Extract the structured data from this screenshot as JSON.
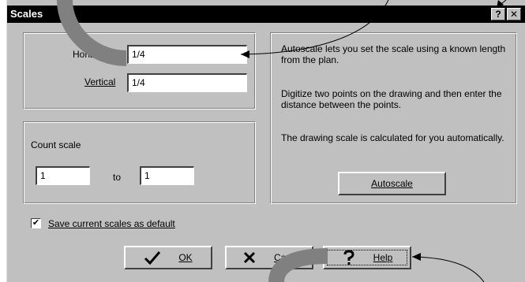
{
  "dialog": {
    "title": "Scales",
    "help_glyph": "?",
    "close_glyph": "✕"
  },
  "scale": {
    "horizontal_label": "Horiz",
    "horizontal_value": "1/4",
    "vertical_label": "Vertical",
    "vertical_value": "1/4"
  },
  "count": {
    "label": "Count scale",
    "from_value": "1",
    "to_label": "to",
    "to_value": "1"
  },
  "autoscale": {
    "text1": "Autoscale lets you set the scale using a known length from the plan.",
    "text2": "Digitize two points on the drawing and then enter the distance between the points.",
    "text3": "The drawing scale is calculated for you automatically.",
    "button_label": "Autoscale"
  },
  "save_default": {
    "label": "Save current scales as default",
    "checked": true,
    "check_glyph": "✔"
  },
  "buttons": {
    "ok_label": "OK",
    "cancel_label": "Canc",
    "help_label": "Help",
    "ok_icon": "checkmark-icon",
    "cancel_icon": "x-icon",
    "help_icon": "question-icon"
  },
  "colors": {
    "dialog_face": "#c0c0c0",
    "title_bar": "#000000",
    "callout_band": "#808080"
  }
}
